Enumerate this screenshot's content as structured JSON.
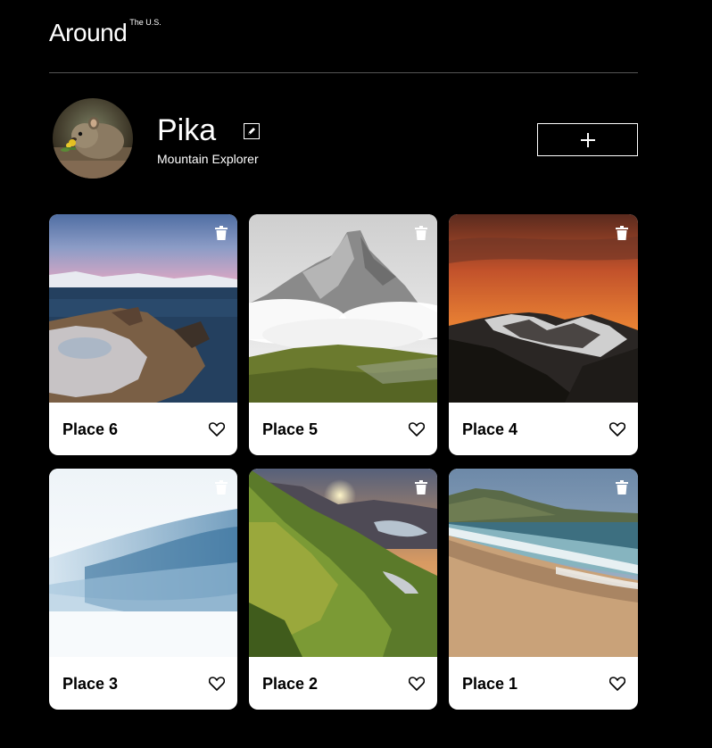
{
  "header": {
    "logo_text": "Around",
    "logo_superscript": "The U.S."
  },
  "profile": {
    "name": "Pika",
    "description": "Mountain Explorer"
  },
  "icons": {
    "edit": "pencil-icon",
    "add": "plus-icon",
    "delete": "trash-icon",
    "like": "heart-outline-icon"
  },
  "colors": {
    "background": "#000000",
    "card_background": "#ffffff",
    "text_dark": "#000000",
    "text_light": "#ffffff",
    "divider": "#545454"
  },
  "cards": [
    {
      "title": "Place 6"
    },
    {
      "title": "Place 5"
    },
    {
      "title": "Place 4"
    },
    {
      "title": "Place 3"
    },
    {
      "title": "Place 2"
    },
    {
      "title": "Place 1"
    }
  ]
}
